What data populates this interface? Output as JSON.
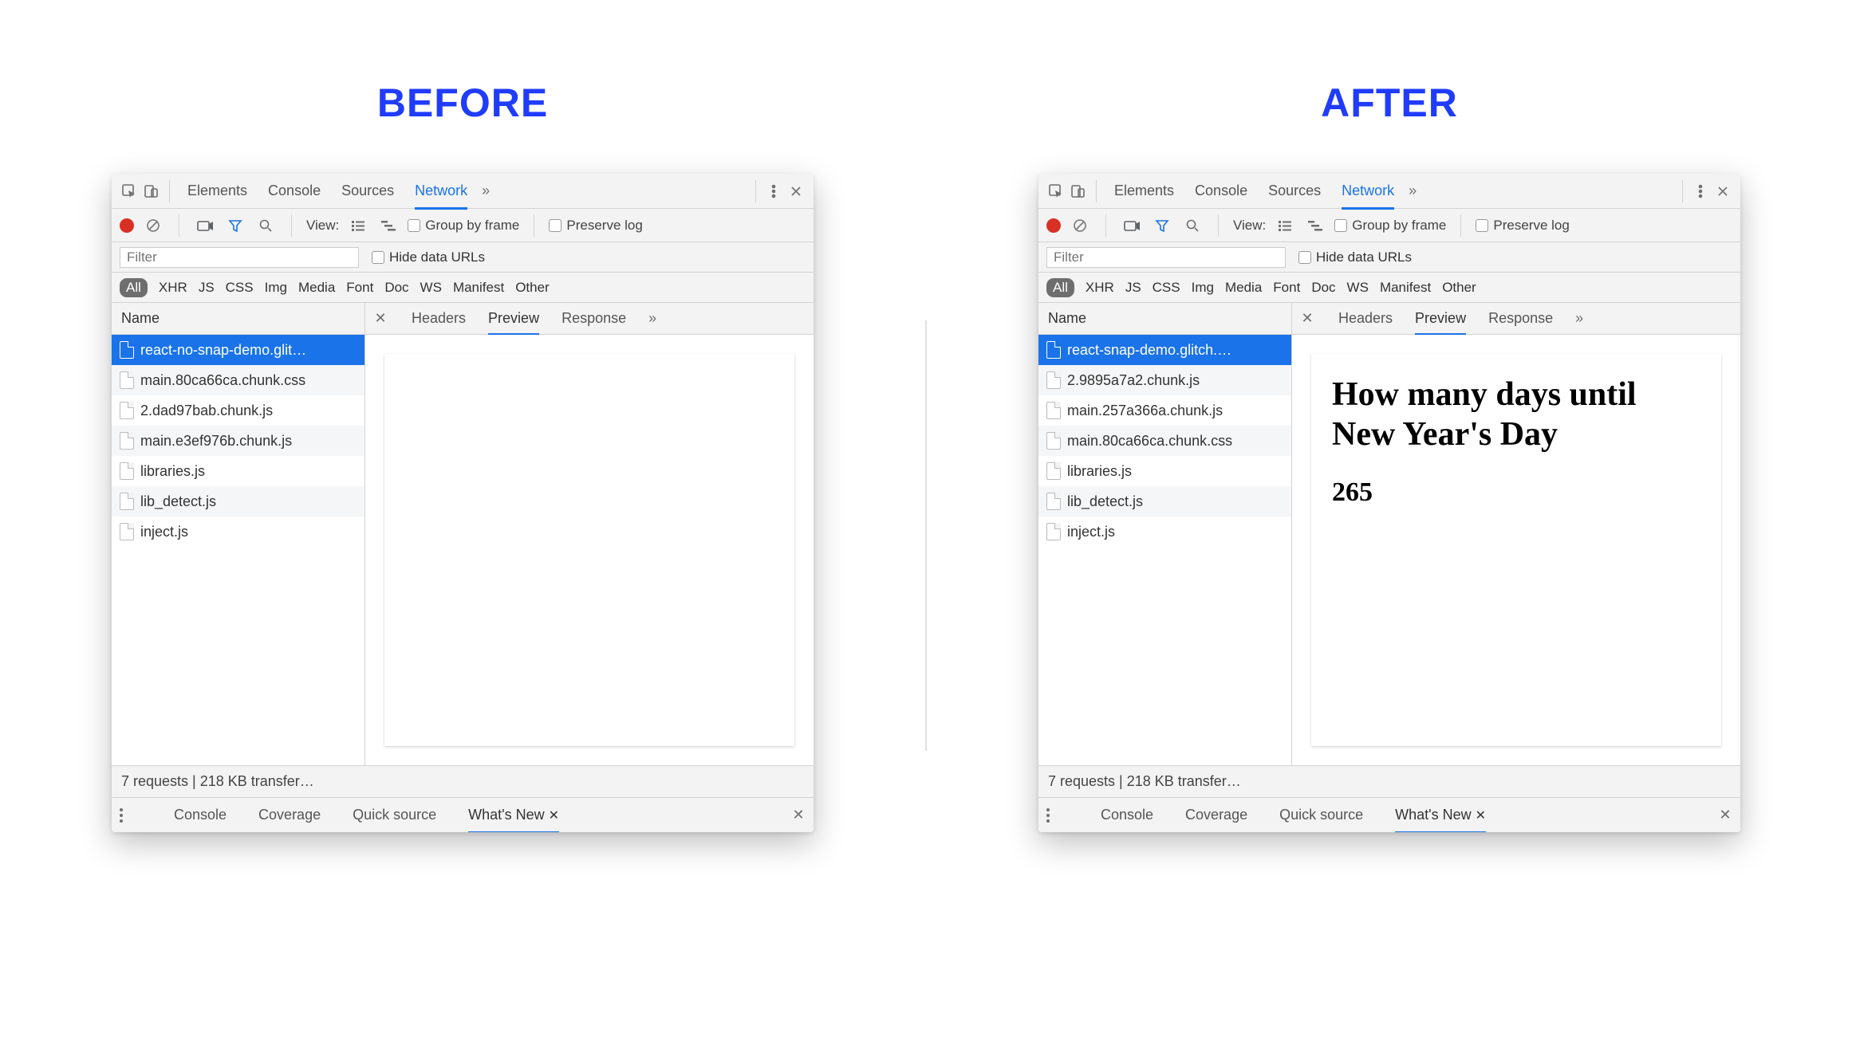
{
  "headings": {
    "before": "BEFORE",
    "after": "AFTER"
  },
  "main_tabs": [
    "Elements",
    "Console",
    "Sources",
    "Network"
  ],
  "active_main_tab": "Network",
  "toolbar": {
    "view_label": "View:",
    "group_by_frame": "Group by frame",
    "preserve_log": "Preserve log"
  },
  "filter": {
    "placeholder": "Filter",
    "hide_data_urls": "Hide data URLs"
  },
  "filter_types": [
    "All",
    "XHR",
    "JS",
    "CSS",
    "Img",
    "Media",
    "Font",
    "Doc",
    "WS",
    "Manifest",
    "Other"
  ],
  "name_header": "Name",
  "preview_tabs": [
    "Headers",
    "Preview",
    "Response"
  ],
  "active_preview_tab": "Preview",
  "requests_before": [
    "react-no-snap-demo.glit…",
    "main.80ca66ca.chunk.css",
    "2.dad97bab.chunk.js",
    "main.e3ef976b.chunk.js",
    "libraries.js",
    "lib_detect.js",
    "inject.js"
  ],
  "requests_after": [
    "react-snap-demo.glitch.…",
    "2.9895a7a2.chunk.js",
    "main.257a366a.chunk.js",
    "main.80ca66ca.chunk.css",
    "libraries.js",
    "lib_detect.js",
    "inject.js"
  ],
  "preview_after": {
    "heading": "How many days until New Year's Day",
    "value": "265"
  },
  "status_text": "7 requests | 218 KB transfer…",
  "drawer_tabs": [
    "Console",
    "Coverage",
    "Quick source",
    "What's New"
  ],
  "active_drawer_tab": "What's New"
}
